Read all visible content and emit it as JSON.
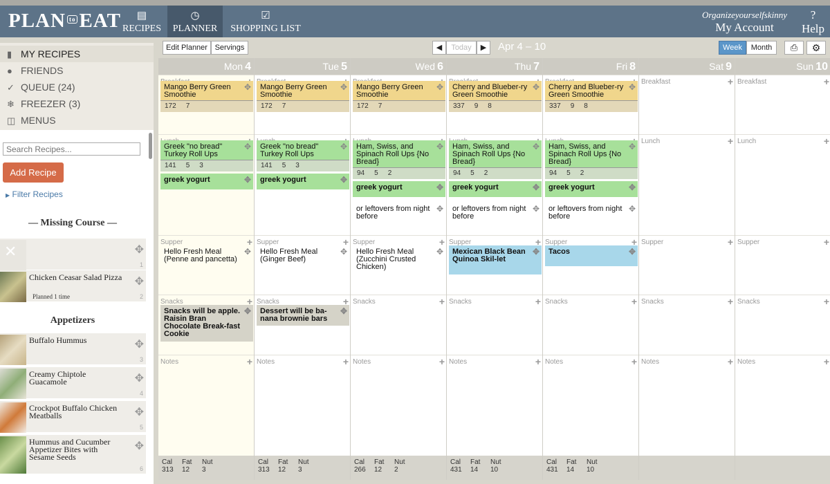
{
  "app": {
    "logo_left": "PLAN",
    "logo_mid": "to",
    "logo_right": "EAT",
    "nav": [
      {
        "label": "RECIPES",
        "icon": "recipe-cards-icon"
      },
      {
        "label": "PLANNER",
        "icon": "clock-icon"
      },
      {
        "label": "SHOPPING LIST",
        "icon": "checklist-icon"
      }
    ],
    "user": "Organizeyourselfskinny",
    "account_label": "My Account",
    "help_mark": "?",
    "help_label": "Help"
  },
  "sidebar": {
    "nav": [
      {
        "label": "MY RECIPES",
        "icon": "book-icon"
      },
      {
        "label": "FRIENDS",
        "icon": "person-icon"
      },
      {
        "label": "QUEUE (24)",
        "icon": "check-icon"
      },
      {
        "label": "FREEZER (3)",
        "icon": "snowflake-icon"
      },
      {
        "label": "MENUS",
        "icon": "menu-book-icon"
      }
    ],
    "search_placeholder": "Search Recipes...",
    "add_recipe": "Add Recipe",
    "filter_label": "Filter Recipes",
    "missing_course": "— Missing Course —",
    "missing": [
      {
        "name": "",
        "num": "1"
      },
      {
        "name": "Chicken Ceasar Salad Pizza",
        "planned": "Planned 1 time",
        "num": "2"
      }
    ],
    "appetizers_head": "Appetizers",
    "appetizers": [
      {
        "name": "Buffalo Hummus",
        "num": "3"
      },
      {
        "name": "Creamy Chiptole Guacamole",
        "num": "4"
      },
      {
        "name": "Crockpot Buffalo Chicken Meatballs",
        "num": "5"
      },
      {
        "name": "Hummus and Cucumber Appetizer Bites with Sesame Seeds",
        "num": "6"
      }
    ]
  },
  "toolbar": {
    "edit_planner": "Edit Planner",
    "servings": "Servings",
    "today": "Today",
    "date_range": "Apr 4 – 10",
    "week": "Week",
    "month": "Month"
  },
  "slots": {
    "breakfast": "Breakfast",
    "lunch": "Lunch",
    "supper": "Supper",
    "snacks": "Snacks",
    "notes": "Notes"
  },
  "footer_labels": {
    "cal": "Cal",
    "fat": "Fat",
    "nut": "Nut"
  },
  "days": [
    {
      "name": "Mon",
      "num": "4",
      "cal": "313",
      "fat": "12",
      "nut": "3"
    },
    {
      "name": "Tue",
      "num": "5",
      "cal": "313",
      "fat": "12",
      "nut": "3"
    },
    {
      "name": "Wed",
      "num": "6",
      "cal": "266",
      "fat": "12",
      "nut": "2"
    },
    {
      "name": "Thu",
      "num": "7",
      "cal": "431",
      "fat": "14",
      "nut": "10"
    },
    {
      "name": "Fri",
      "num": "8",
      "cal": "431",
      "fat": "14",
      "nut": "10"
    },
    {
      "name": "Sat",
      "num": "9",
      "cal": "",
      "fat": "",
      "nut": ""
    },
    {
      "name": "Sun",
      "num": "10",
      "cal": "",
      "fat": "",
      "nut": ""
    }
  ],
  "meals": {
    "mango": {
      "title": "Mango Berry Green Smoothie",
      "n1": "172",
      "n2": "7",
      "n3": ""
    },
    "cherry": {
      "title": "Cherry and Blueber-ry Green Smoothie",
      "n1": "337",
      "n2": "9",
      "n3": "8"
    },
    "greek_roll": {
      "title": "Greek \"no bread\" Turkey Roll Ups",
      "n1": "141",
      "n2": "5",
      "n3": "3"
    },
    "ham_swiss": {
      "title": "Ham, Swiss, and Spinach Roll Ups {No Bread}",
      "n1": "94",
      "n2": "5",
      "n3": "2"
    },
    "greek_yogurt": "greek yogurt",
    "leftovers": "or leftovers from night before",
    "hf_penne": "Hello Fresh Meal (Penne and pancetta)",
    "hf_ginger": "Hello Fresh Meal (Ginger Beef)",
    "hf_zucchini": "Hello Fresh Meal (Zucchini Crusted Chicken)",
    "mexican": "Mexican Black Bean Quinoa Skil-let",
    "tacos": "Tacos",
    "snack_mon": "Snacks will be apple. Raisin Bran Chocolate Break-fast Cookie",
    "snack_tue": "Dessert will be ba-nana brownie bars"
  }
}
